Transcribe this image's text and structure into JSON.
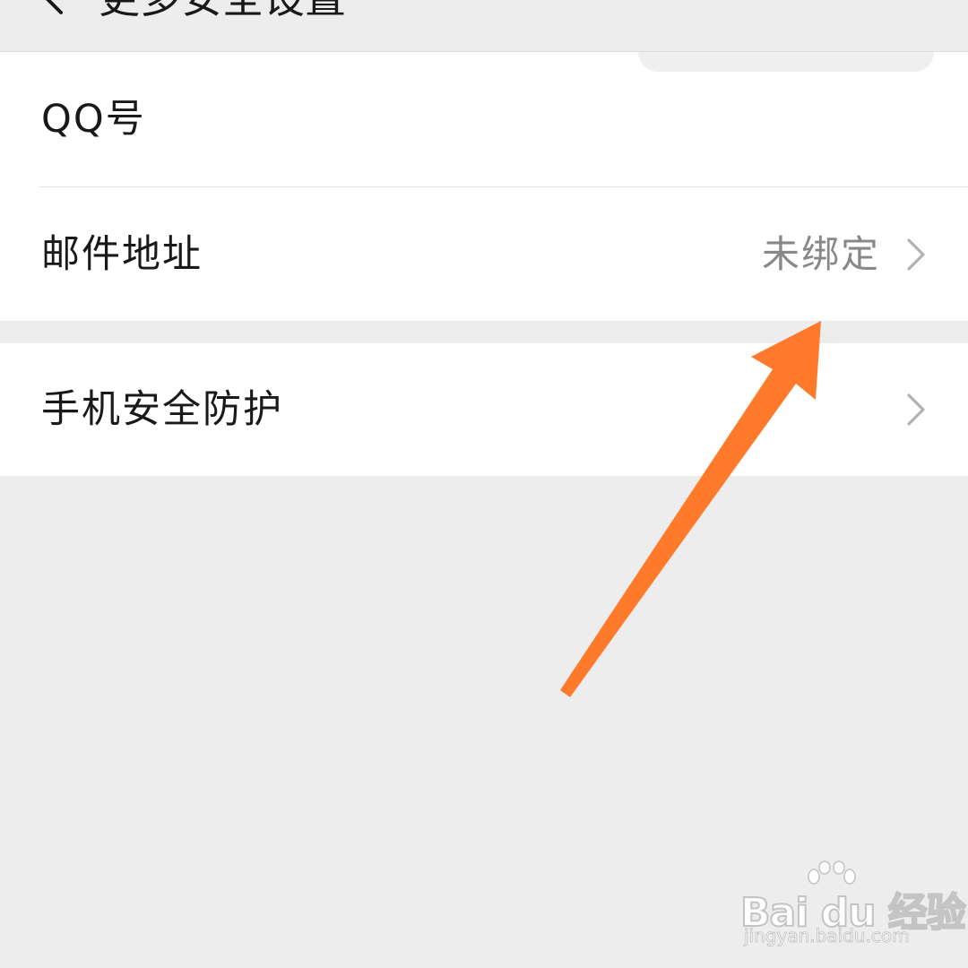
{
  "header": {
    "title": "更多安全设置",
    "back_icon": "chevron-left-icon"
  },
  "settings": {
    "qq_label": "QQ号",
    "email_label": "邮件地址",
    "email_value": "未绑定",
    "phone_security_label": "手机安全防护",
    "chevron_icon": "chevron-right-icon"
  },
  "annotation": {
    "arrow_color": "#ff7a2a"
  },
  "watermark": {
    "logo_text": "Bai du 经验",
    "url": "jingyan.baidu.com"
  },
  "colors": {
    "background": "#ededed",
    "card": "#ffffff",
    "text_primary": "#191919",
    "text_secondary": "#888888"
  }
}
